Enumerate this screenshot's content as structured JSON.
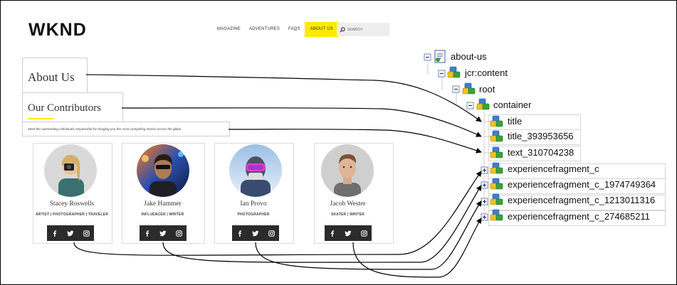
{
  "site": {
    "logo": "WKND",
    "nav": [
      "MAGAZINE",
      "ADVENTURES",
      "FAQS",
      "ABOUT US"
    ],
    "active_nav": "ABOUT US",
    "search_placeholder": "SEARCH"
  },
  "page": {
    "title": "About Us",
    "subtitle": "Our Contributors",
    "description": "Meet the outstanding individuals responsible for bringing you the most compelling stories across the globe."
  },
  "contributors": [
    {
      "name": "Stacey Roswells",
      "role": "ARTIST | PHOTOGRAPHER | TRAVELER"
    },
    {
      "name": "Jake Hammer",
      "role": "INFLUENCER | WRITER"
    },
    {
      "name": "Ian Provo",
      "role": "PHOTOGRAPHER"
    },
    {
      "name": "Jacob Wester",
      "role": "SKATER | WRITER"
    }
  ],
  "social_icons": [
    "facebook-icon",
    "twitter-icon",
    "instagram-icon"
  ],
  "tree": {
    "root": "about-us",
    "jcr": "jcr:content",
    "rootnode": "root",
    "container": "container",
    "children": [
      "title",
      "title_393953656",
      "text_310704238",
      "experiencefragment_c",
      "experiencefragment_c_1974749364",
      "experiencefragment_c_1213011316",
      "experiencefragment_c_274685211"
    ]
  },
  "colors": {
    "accent_yellow": "#ffea00",
    "social_bar": "#2b2b2b",
    "tree_expander": "#6f86b8"
  }
}
